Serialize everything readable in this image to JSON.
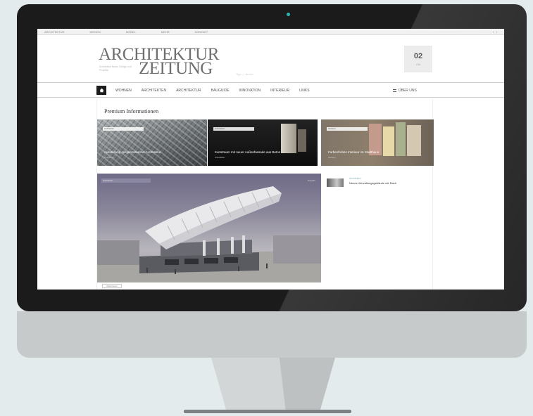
{
  "site": {
    "topbar_links": [
      "ARCHITEKTUR",
      "DESIGN",
      "MÖBEL",
      "MEHR",
      "KONTAKT"
    ],
    "topbar_right": [
      "f",
      "t"
    ],
    "logo_line1": "ARCHITEKTUR",
    "logo_line2": "ZEITUNG",
    "logo_sub": "Architektur News, Design und Projekte",
    "masthead_text": "Tipp — Archiv",
    "date_day": "02",
    "date_month": "Okt",
    "nav_items": [
      "Wohnen",
      "Architekten",
      "Architektur",
      "Bauguide",
      "Innovation",
      "Interieur",
      "Links"
    ],
    "nav_right": "Über uns"
  },
  "featured": {
    "section_title": "Premium Informationen",
    "items": [
      {
        "tag": "Architektur",
        "caption": "Ausstellung zeitgenössischer Architektur",
        "meta": "Architektur"
      },
      {
        "tag": "Architektur",
        "caption": "Kunstraum mit neuer Außenfassade aus Beton",
        "meta": "Architektur"
      },
      {
        "tag": "Interieur",
        "caption": "Farbenfrohes Interieur im Stadthaus",
        "meta": "Interieur"
      }
    ]
  },
  "hero": {
    "tag": "Architektur",
    "tag_right": "Projekte",
    "below_tag": "Weiterlesen"
  },
  "sidebar": {
    "category": "Architektur",
    "title": "Neues Verwaltungsgebäude mit Dach"
  },
  "colors": {
    "background": "#e4ebec",
    "bezel": "#1b1b1b",
    "chin": "#c7cacb",
    "camera": "#2fb7b2",
    "nav_home": "#1d1d1d",
    "sidebar_category": "#8fb5bd"
  }
}
